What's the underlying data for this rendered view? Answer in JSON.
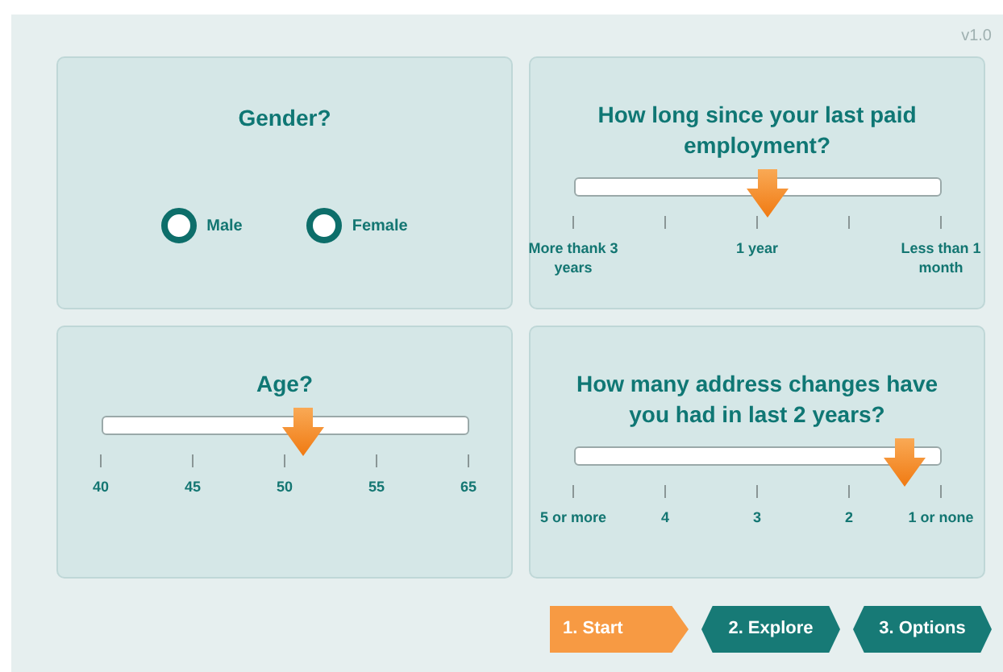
{
  "version": "v1.0",
  "questions": [
    {
      "kind": "radio",
      "title": "Gender?",
      "options": [
        {
          "label": "Male",
          "selected": false
        },
        {
          "label": "Female",
          "selected": false
        }
      ]
    },
    {
      "kind": "slider",
      "title": "How long since your last paid employment?",
      "level": 0.53,
      "ticks": [
        {
          "kind": "major",
          "label": "More thank 3 years"
        },
        {
          "kind": "minor"
        },
        {
          "kind": "major",
          "label": "1 year"
        },
        {
          "kind": "minor"
        },
        {
          "kind": "major",
          "label": "Less than 1 month"
        }
      ]
    },
    {
      "kind": "slider",
      "title": "Age?",
      "level": 0.55,
      "ticks": [
        {
          "kind": "major",
          "label": "40"
        },
        {
          "kind": "major",
          "label": "45"
        },
        {
          "kind": "major",
          "label": "50"
        },
        {
          "kind": "major",
          "label": "55"
        },
        {
          "kind": "major",
          "label": "65"
        }
      ]
    },
    {
      "kind": "slider",
      "title": "How many address changes have you had in last 2 years?",
      "level": 0.9,
      "ticks": [
        {
          "kind": "major",
          "label": "5 or more"
        },
        {
          "kind": "major",
          "label": "4"
        },
        {
          "kind": "major",
          "label": "3"
        },
        {
          "kind": "major",
          "label": "2"
        },
        {
          "kind": "major",
          "label": "1 or none"
        }
      ]
    }
  ],
  "steps": [
    {
      "label": "1. Start",
      "selected": true
    },
    {
      "label": "2. Explore",
      "selected": false
    },
    {
      "label": "3. Options",
      "selected": false
    }
  ]
}
